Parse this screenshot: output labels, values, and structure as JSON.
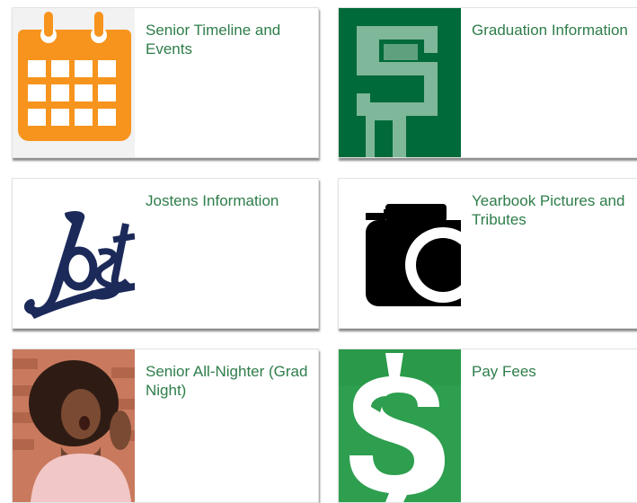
{
  "accent_color": "#2e7d4a",
  "cards": [
    {
      "title": "Senior Timeline and Events",
      "icon": "calendar-icon"
    },
    {
      "title": "Graduation Information",
      "icon": "school-logo-icon"
    },
    {
      "title": "Jostens Information",
      "icon": "jostens-logo-icon"
    },
    {
      "title": "Yearbook Pictures and Tributes",
      "icon": "camera-icon"
    },
    {
      "title": "Senior All-Nighter (Grad Night)",
      "icon": "yawning-person-photo"
    },
    {
      "title": "Pay Fees",
      "icon": "dollar-sign-icon"
    }
  ]
}
